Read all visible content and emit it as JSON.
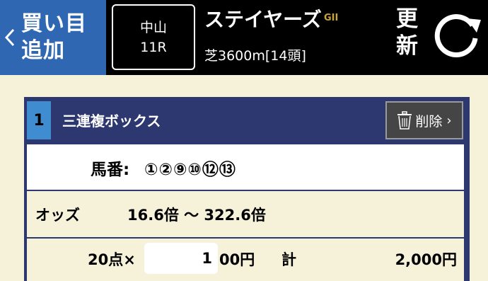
{
  "header": {
    "add_button_label": "買い目\n追加",
    "venue": "中山",
    "race_number": "11R",
    "race_name": "ステイヤーズ",
    "grade": "GII",
    "race_info": "芝3600m[14頭]",
    "refresh_label": "更\n新"
  },
  "ticket": {
    "number": "1",
    "bet_type": "三連複ボックス",
    "delete_label": "削除",
    "numbers_label": "馬番:",
    "numbers_value": "①②⑨⑩⑫⑬",
    "odds_label": "オッズ",
    "odds_value": "16.6倍 ～ 322.6倍",
    "points": "20点×",
    "amount_input": "1",
    "amount_unit": "00円",
    "total_label": "計",
    "total_value": "2,000円"
  },
  "colors": {
    "header_bg": "#000000",
    "add_button_bg": "#2f67b2",
    "ticket_frame": "#2e3870",
    "ticket_number_bg": "#3f8cd0",
    "grade": "#c9a33a",
    "page_bg": "#f6f1d9"
  },
  "icons": [
    "chevron-left-icon",
    "refresh-icon",
    "trash-icon",
    "chevron-right-icon"
  ]
}
